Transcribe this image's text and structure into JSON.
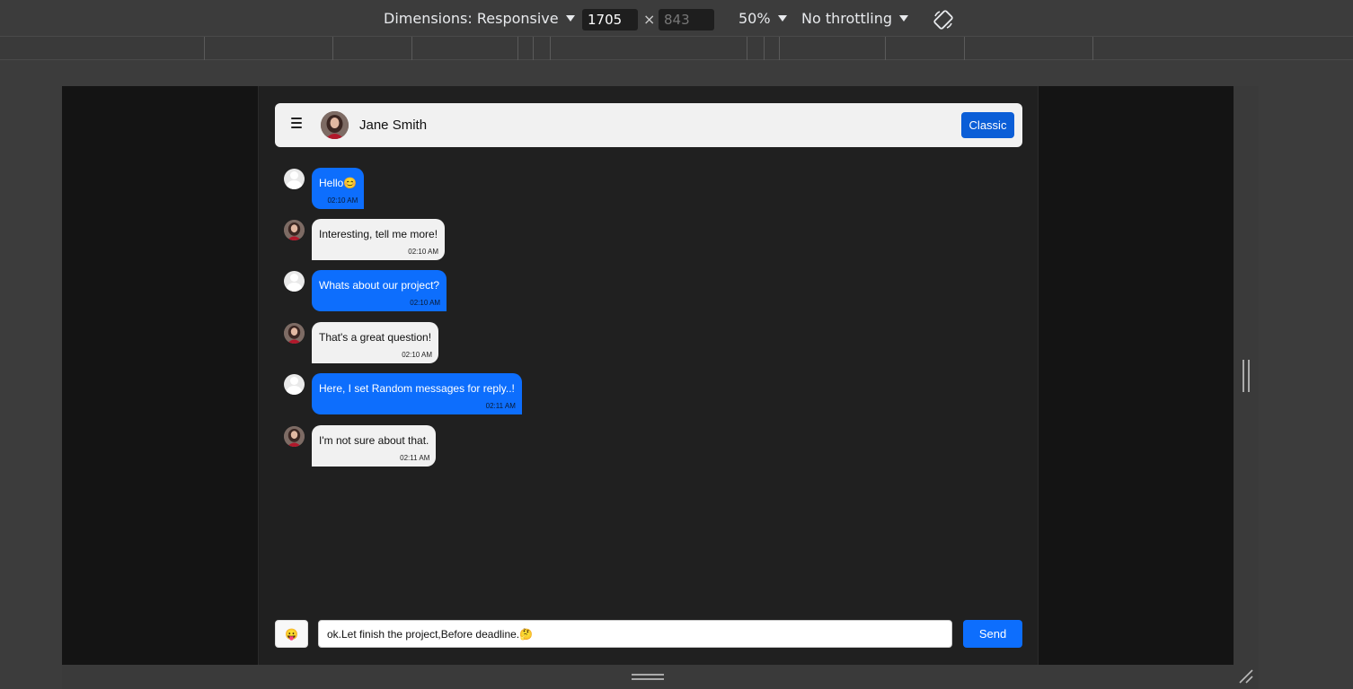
{
  "devtools": {
    "dimensions_label": "Dimensions: Responsive",
    "width_value": "1705",
    "height_value": "843",
    "times_symbol": "×",
    "zoom": "50%",
    "throttling": "No throttling",
    "rotate_icon": "rotate-icon"
  },
  "header": {
    "contact_name": "Jane Smith",
    "classic_label": "Classic",
    "menu_icon": "hamburger-menu-icon"
  },
  "messages": [
    {
      "from": "user",
      "text": "Hello😊",
      "time": "02:10 AM"
    },
    {
      "from": "jane",
      "text": "Interesting, tell me more!",
      "time": "02:10 AM"
    },
    {
      "from": "user",
      "text": "Whats about our project?",
      "time": "02:10 AM"
    },
    {
      "from": "jane",
      "text": "That's a great question!",
      "time": "02:10 AM"
    },
    {
      "from": "user",
      "text": "Here, I set Random messages for reply..!",
      "time": "02:11 AM"
    },
    {
      "from": "jane",
      "text": "I'm not sure about that.",
      "time": "02:11 AM"
    }
  ],
  "composer": {
    "emoji": "😛",
    "input_value": "ok.Let finish the project,Before deadline.🤔",
    "send_label": "Send"
  },
  "colors": {
    "sent_bubble": "#0d6efd",
    "received_bubble": "#f1f1f1",
    "classic_button": "#0b5ed7",
    "app_background": "#202020"
  }
}
